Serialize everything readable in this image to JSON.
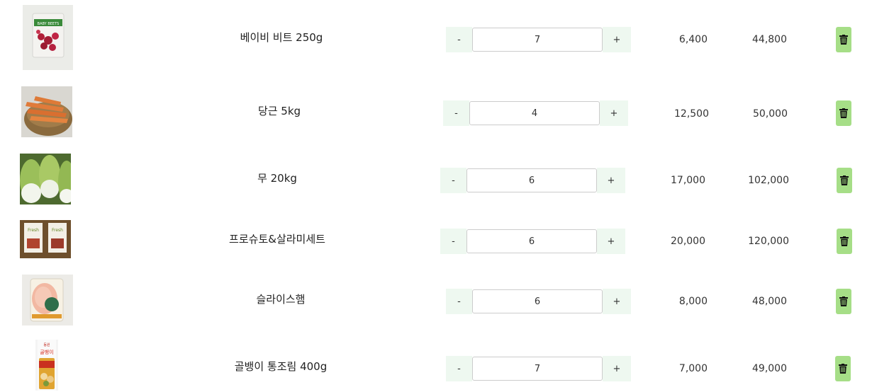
{
  "cart": {
    "items": [
      {
        "name": "베이비 비트 250g",
        "quantity": "7",
        "unit_price": "6,400",
        "total": "44,800",
        "image": "beet-bag-image",
        "thumb_color": "#e9eae6"
      },
      {
        "name": "당근 5kg",
        "quantity": "4",
        "unit_price": "12,500",
        "total": "50,000",
        "image": "carrots-basket-image",
        "thumb_color": "#d8d6d0"
      },
      {
        "name": "무 20kg",
        "quantity": "6",
        "unit_price": "17,000",
        "total": "102,000",
        "image": "radish-image",
        "thumb_color": "#5e7b3a"
      },
      {
        "name": "프로슈토&살라미세트",
        "quantity": "6",
        "unit_price": "20,000",
        "total": "120,000",
        "image": "prosciutto-salami-set-image",
        "thumb_color": "#7a5a34"
      },
      {
        "name": "슬라이스햄",
        "quantity": "6",
        "unit_price": "8,000",
        "total": "48,000",
        "image": "sliced-ham-image",
        "thumb_color": "#ededea"
      },
      {
        "name": "골뱅이 통조림 400g",
        "quantity": "7",
        "unit_price": "7,000",
        "total": "49,000",
        "image": "whelk-can-image",
        "thumb_color": "#f2f2f2"
      }
    ],
    "minus_label": "-",
    "plus_label": "+"
  },
  "colors": {
    "qty_button_bg": "#eef8f0",
    "delete_button_bg": "#a6de87"
  },
  "icons": {
    "delete": "trash-icon"
  }
}
